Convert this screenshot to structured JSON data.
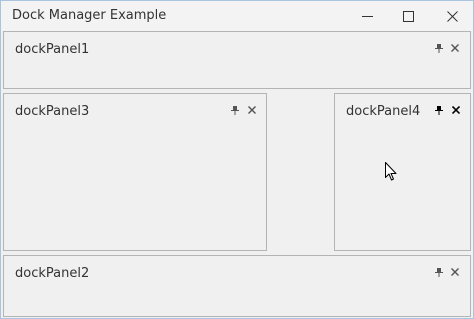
{
  "window": {
    "title": "Dock Manager Example"
  },
  "panels": {
    "panel1": {
      "caption": "dockPanel1"
    },
    "panel3": {
      "caption": "dockPanel3"
    },
    "panel4": {
      "caption": "dockPanel4"
    },
    "panel2": {
      "caption": "dockPanel2"
    }
  },
  "icons": {
    "minimize": "minimize-icon",
    "maximize": "maximize-icon",
    "close": "close-icon",
    "pin": "pin-icon",
    "panel_close": "panel-close-icon",
    "cursor": "mouse-cursor-icon"
  },
  "colors": {
    "window_border": "#a8c4e0",
    "panel_border": "#b4b4b4",
    "background": "#f0f0f0",
    "icon_active": "#000000",
    "icon_inactive": "#555555"
  }
}
